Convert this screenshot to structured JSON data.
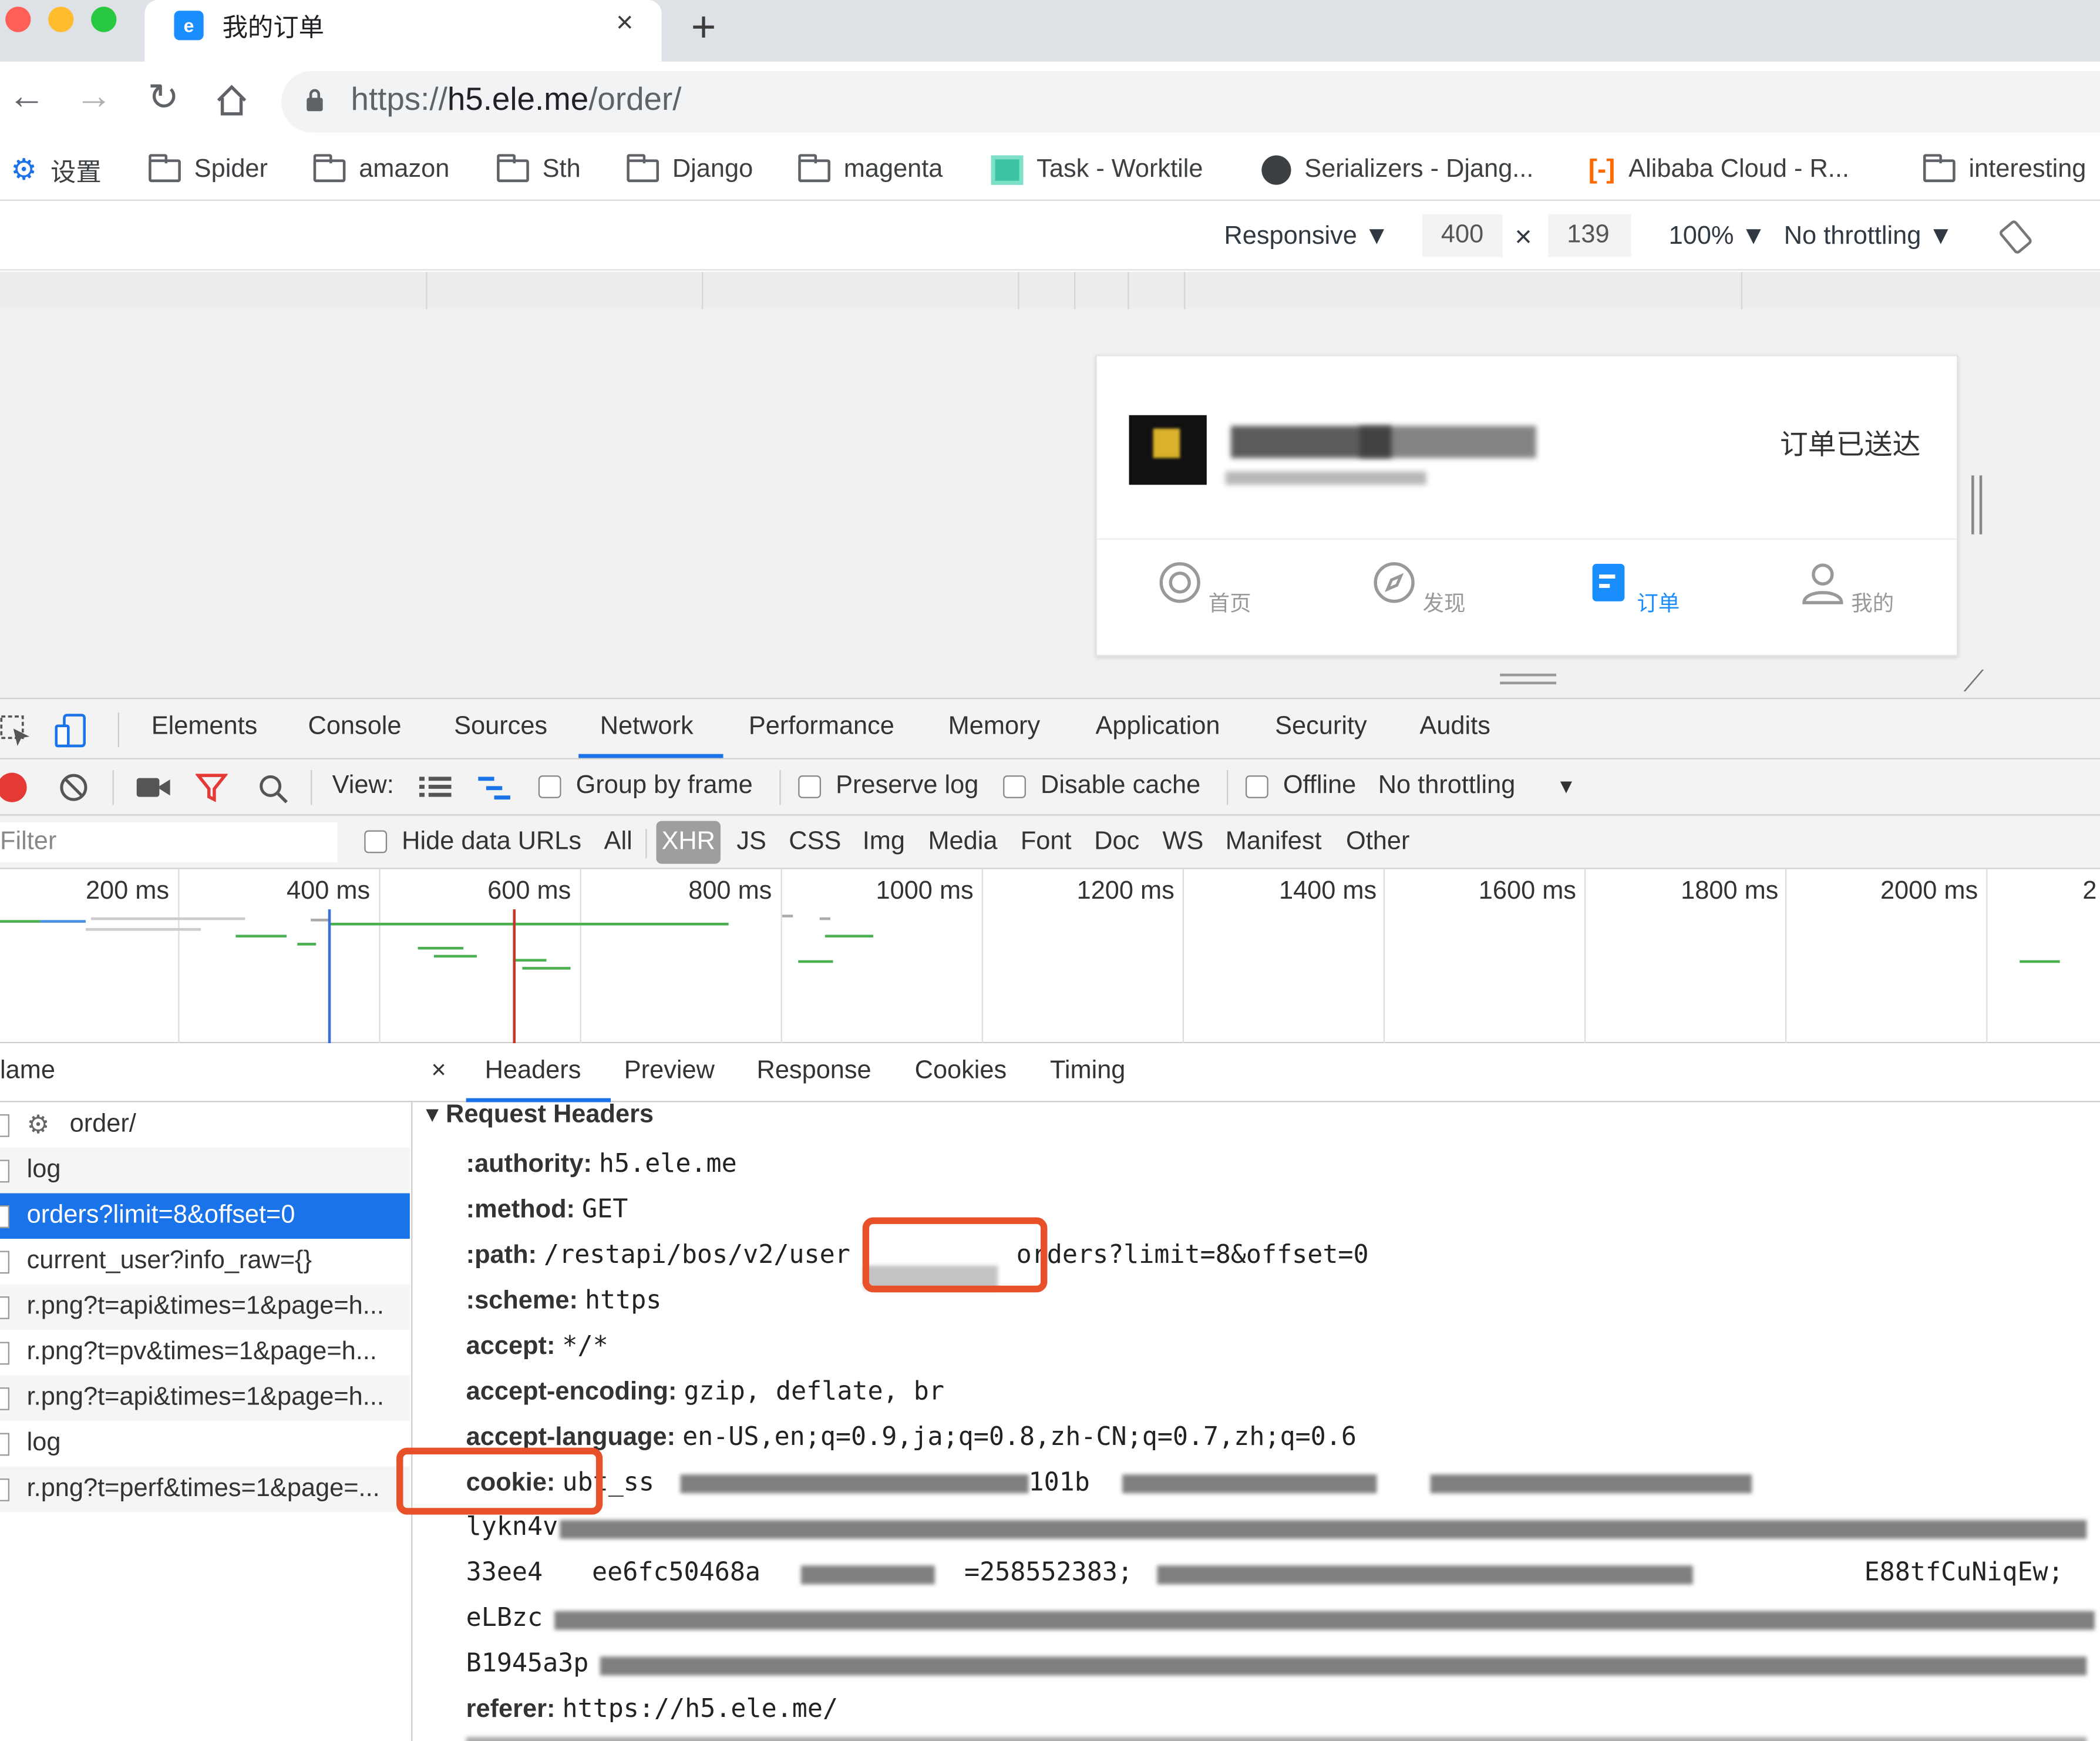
{
  "browser": {
    "tab_title": "我的订单",
    "tab_close": "×",
    "new_tab": "+",
    "url_scheme": "https://",
    "url_host": "h5.ele.me",
    "url_path": "/order/"
  },
  "bookmarks": [
    {
      "label": "设置",
      "icon": "gear-icon"
    },
    {
      "label": "Spider",
      "icon": "folder-icon"
    },
    {
      "label": "amazon",
      "icon": "folder-icon"
    },
    {
      "label": "Sth",
      "icon": "folder-icon"
    },
    {
      "label": "Django",
      "icon": "folder-icon"
    },
    {
      "label": "magenta",
      "icon": "folder-icon"
    },
    {
      "label": "Task - Worktile",
      "icon": "worktile-icon"
    },
    {
      "label": "Serializers - Djang...",
      "icon": "globe-icon"
    },
    {
      "label": "Alibaba Cloud - R...",
      "icon": "alibaba-icon"
    },
    {
      "label": "interesting",
      "icon": "folder-icon"
    }
  ],
  "device_toolbar": {
    "device": "Responsive ▼",
    "width": "400",
    "times": "×",
    "height": "139",
    "zoom": "100% ▼",
    "throttling": "No throttling ▼"
  },
  "page": {
    "order_status": "订单已送达",
    "tabbar": [
      {
        "label": "首页",
        "active": false
      },
      {
        "label": "发现",
        "active": false
      },
      {
        "label": "订单",
        "active": true
      },
      {
        "label": "我的",
        "active": false
      }
    ],
    "accent": "#1a8dff"
  },
  "devtools": {
    "tabs": [
      "Elements",
      "Console",
      "Sources",
      "Network",
      "Performance",
      "Memory",
      "Application",
      "Security",
      "Audits"
    ],
    "active_tab": "Network",
    "toolbar": {
      "view": "View:",
      "group_by_frame": "Group by frame",
      "preserve_log": "Preserve log",
      "disable_cache": "Disable cache",
      "offline": "Offline",
      "throttling": "No throttling",
      "caret": "▼"
    },
    "filter": {
      "placeholder": "Filter",
      "hide_data_urls": "Hide data URLs",
      "types": [
        "All",
        "XHR",
        "JS",
        "CSS",
        "Img",
        "Media",
        "Font",
        "Doc",
        "WS",
        "Manifest",
        "Other"
      ],
      "active_type": "XHR"
    },
    "timeline_ticks": [
      "200 ms",
      "400 ms",
      "600 ms",
      "800 ms",
      "1000 ms",
      "1200 ms",
      "1400 ms",
      "1600 ms",
      "1800 ms",
      "2000 ms",
      "2"
    ],
    "requests_header": "lame",
    "requests": [
      {
        "name": "order/",
        "selected": false,
        "doc": true
      },
      {
        "name": "log",
        "selected": false
      },
      {
        "name": "orders?limit=8&offset=0",
        "selected": true
      },
      {
        "name": "current_user?info_raw={}",
        "selected": false
      },
      {
        "name": "r.png?t=api&times=1&page=h...",
        "selected": false
      },
      {
        "name": "r.png?t=pv&times=1&page=h...",
        "selected": false
      },
      {
        "name": "r.png?t=api&times=1&page=h...",
        "selected": false
      },
      {
        "name": "log",
        "selected": false
      },
      {
        "name": "r.png?t=perf&times=1&page=...",
        "selected": false
      }
    ],
    "detail_tabs": [
      "Headers",
      "Preview",
      "Response",
      "Cookies",
      "Timing"
    ],
    "detail_close": "×",
    "section_title": "▾ Request Headers",
    "headers": [
      {
        "key": ":authority:",
        "value": "h5.ele.me"
      },
      {
        "key": ":method:",
        "value": "GET"
      },
      {
        "key": ":path:",
        "value": "/restapi/bos/v2/user",
        "value_tail": "orders?limit=8&offset=0"
      },
      {
        "key": ":scheme:",
        "value": "https"
      },
      {
        "key": "accept:",
        "value": "*/*"
      },
      {
        "key": "accept-encoding:",
        "value": "gzip, deflate, br"
      },
      {
        "key": "accept-language:",
        "value": "en-US,en;q=0.9,ja;q=0.8,zh-CN;q=0.7,zh;q=0.6"
      },
      {
        "key": "cookie:",
        "value": "ubt_ss"
      },
      {
        "key": "referer:",
        "value": "https://h5.ele.me/"
      }
    ],
    "cookie_fragments": [
      "lykn4v",
      "33ee4",
      "ee6fc50468a",
      "=258552383;",
      "E88tfCuNiqEw;",
      "eLBzc",
      "B1945a3p",
      "101b"
    ]
  }
}
